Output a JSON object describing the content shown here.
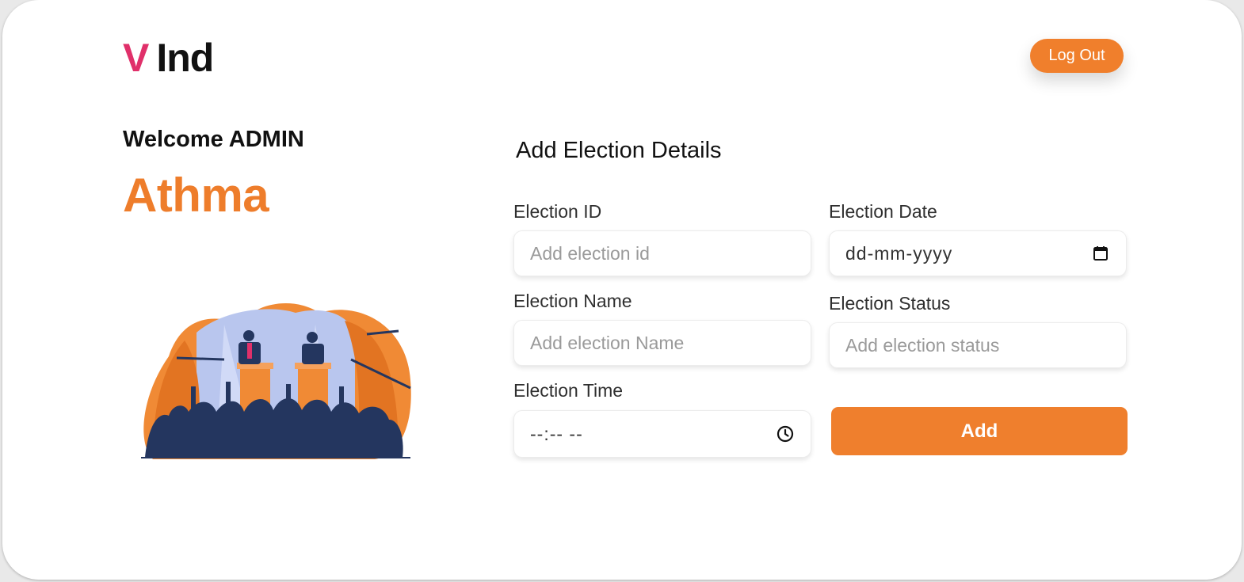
{
  "brand": {
    "logo_first": "V",
    "logo_rest": "Ind"
  },
  "header": {
    "logout_label": "Log Out"
  },
  "sidebar": {
    "welcome_text": "Welcome ADMIN",
    "user_name": "Athma"
  },
  "form": {
    "title": "Add Election Details",
    "election_id": {
      "label": "Election ID",
      "placeholder": "Add election id"
    },
    "election_date": {
      "label": "Election Date",
      "value": "dd-mm-yyyy"
    },
    "election_name": {
      "label": "Election Name",
      "placeholder": "Add election Name"
    },
    "election_status": {
      "label": "Election Status",
      "placeholder": "Add election status"
    },
    "election_time": {
      "label": "Election Time",
      "value": "--:-- --"
    },
    "submit_label": "Add"
  },
  "colors": {
    "accent": "#ef7f2d",
    "logo_accent": "#e0306a",
    "illustration_navy": "#24365f"
  },
  "icons": {
    "date": "calendar-icon",
    "time": "clock-icon"
  }
}
